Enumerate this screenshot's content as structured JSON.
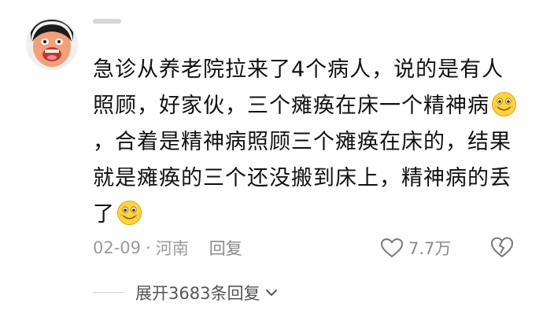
{
  "comment": {
    "segments": [
      "急诊从养老院拉来了4个病人，说的是有人照顾，好家伙，三个瘫痪在床一个精神病",
      "，合着是精神病照顾三个瘫痪在床的，结果就是瘫痪的三个还没搬到床上，精神病的丢了"
    ],
    "emoji": "grin-emoji"
  },
  "meta": {
    "date": "02-09",
    "separator": "·",
    "location": "河南",
    "reply_label": "回复"
  },
  "likes": {
    "count": "7.7万",
    "icon": "heart-outline-icon"
  },
  "dislike": {
    "icon": "broken-heart-icon"
  },
  "replies": {
    "expand_label": "展开3683条回复",
    "icon": "chevron-down-icon"
  },
  "colors": {
    "text": "#111111",
    "meta": "#9a9a9a",
    "emoji_yellow": "#ffd43b"
  }
}
